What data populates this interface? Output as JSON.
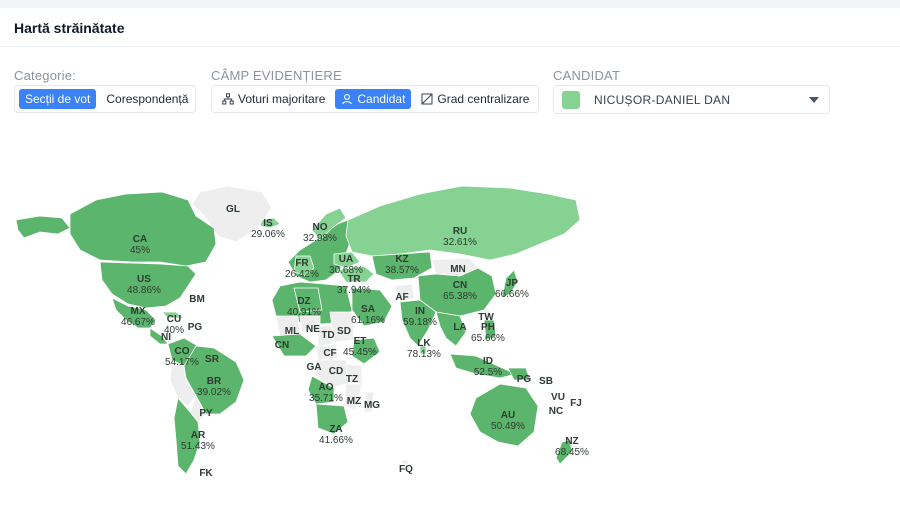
{
  "header": {
    "title": "Hartă străinătate"
  },
  "colors": {
    "accent": "#3b82f6",
    "candidate": "#86d293",
    "dark_green": "#5cb56c",
    "no_data": "#eeeeee"
  },
  "filters": {
    "category": {
      "label": "Categorie:",
      "options": [
        "Secții de vot",
        "Corespondență"
      ],
      "selected": 0
    },
    "field": {
      "label": "CÂMP EVIDENȚIERE",
      "options": [
        {
          "label": "Voturi majoritare",
          "icon": "sitemap-icon"
        },
        {
          "label": "Candidat",
          "icon": "user-icon"
        },
        {
          "label": "Grad centralizare",
          "icon": "chart-square-icon"
        }
      ],
      "selected": 1
    },
    "candidate": {
      "label": "CANDIDAT",
      "value": "NICUȘOR-DANIEL DAN",
      "swatch_color": "#86d293"
    }
  },
  "map": {
    "countries": [
      {
        "code": "GL",
        "percent": ""
      },
      {
        "code": "IS",
        "percent": "29.06%"
      },
      {
        "code": "NO",
        "percent": "32.98%"
      },
      {
        "code": "RU",
        "percent": "32.61%"
      },
      {
        "code": "CA",
        "percent": "45%"
      },
      {
        "code": "FR",
        "percent": "26.42%"
      },
      {
        "code": "UA",
        "percent": "30.68%"
      },
      {
        "code": "TR",
        "percent": "37.94%"
      },
      {
        "code": "KZ",
        "percent": "38.57%"
      },
      {
        "code": "MN",
        "percent": ""
      },
      {
        "code": "US",
        "percent": "48.86%"
      },
      {
        "code": "BM",
        "percent": ""
      },
      {
        "code": "DZ",
        "percent": "40.91%"
      },
      {
        "code": "SA",
        "percent": "61.16%"
      },
      {
        "code": "AF",
        "percent": ""
      },
      {
        "code": "CN",
        "percent": "65.38%"
      },
      {
        "code": "JP",
        "percent": "66.66%"
      },
      {
        "code": "MX",
        "percent": "46.67%"
      },
      {
        "code": "CU",
        "percent": "40%"
      },
      {
        "code": "PG",
        "percent": ""
      },
      {
        "code": "ML",
        "percent": ""
      },
      {
        "code": "NE",
        "percent": ""
      },
      {
        "code": "SD",
        "percent": ""
      },
      {
        "code": "IN",
        "percent": "59.18%"
      },
      {
        "code": "TW",
        "percent": ""
      },
      {
        "code": "PH",
        "percent": "65.66%"
      },
      {
        "code": "NI",
        "percent": ""
      },
      {
        "code": "CN",
        "percent": ""
      },
      {
        "code": "TD",
        "percent": ""
      },
      {
        "code": "ET",
        "percent": "45.45%"
      },
      {
        "code": "CF",
        "percent": ""
      },
      {
        "code": "LK",
        "percent": "78.13%"
      },
      {
        "code": "LA",
        "percent": ""
      },
      {
        "code": "CO",
        "percent": "54.17%"
      },
      {
        "code": "SR",
        "percent": ""
      },
      {
        "code": "GA",
        "percent": ""
      },
      {
        "code": "CD",
        "percent": ""
      },
      {
        "code": "TZ",
        "percent": ""
      },
      {
        "code": "ID",
        "percent": "52.5%"
      },
      {
        "code": "PG",
        "percent": ""
      },
      {
        "code": "SB",
        "percent": ""
      },
      {
        "code": "BR",
        "percent": "39.02%"
      },
      {
        "code": "AO",
        "percent": "35.71%"
      },
      {
        "code": "MZ",
        "percent": ""
      },
      {
        "code": "MG",
        "percent": ""
      },
      {
        "code": "VU",
        "percent": ""
      },
      {
        "code": "FJ",
        "percent": ""
      },
      {
        "code": "NC",
        "percent": ""
      },
      {
        "code": "PY",
        "percent": ""
      },
      {
        "code": "AU",
        "percent": "50.49%"
      },
      {
        "code": "ZA",
        "percent": "41.66%"
      },
      {
        "code": "AR",
        "percent": "51.43%"
      },
      {
        "code": "NZ",
        "percent": "68.45%"
      },
      {
        "code": "FK",
        "percent": ""
      },
      {
        "code": "FQ",
        "percent": ""
      }
    ]
  }
}
